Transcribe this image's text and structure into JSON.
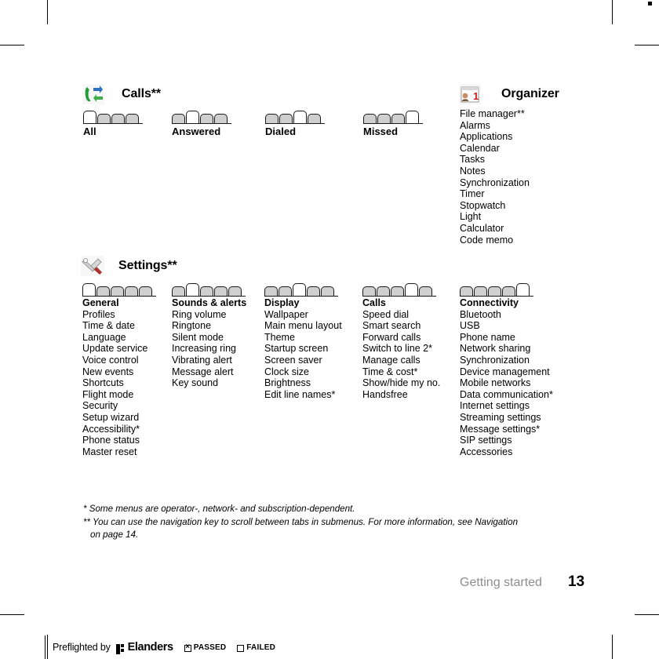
{
  "document": {
    "footer_label": "Getting started",
    "page_number": "13"
  },
  "sections": {
    "calls": {
      "icon": "calls-icon",
      "title": "Calls**",
      "tabs": [
        {
          "label": "All",
          "count": 4,
          "selected_index": 0
        },
        {
          "label": "Answered",
          "count": 4,
          "selected_index": 1
        },
        {
          "label": "Dialed",
          "count": 4,
          "selected_index": 2
        },
        {
          "label": "Missed",
          "count": 4,
          "selected_index": 3
        }
      ]
    },
    "organizer": {
      "icon": "organizer-icon",
      "title": "Organizer",
      "items": [
        "File manager**",
        "Alarms",
        "Applications",
        "Calendar",
        "Tasks",
        "Notes",
        "Synchronization",
        "Timer",
        "Stopwatch",
        "Light",
        "Calculator",
        "Code memo"
      ]
    },
    "settings": {
      "icon": "settings-icon",
      "title": "Settings**",
      "columns": [
        {
          "header": "General",
          "tab_count": 5,
          "selected_index": 0,
          "items": [
            "Profiles",
            "Time & date",
            "Language",
            "Update service",
            "Voice control",
            "New events",
            "Shortcuts",
            "Flight mode",
            "Security",
            "Setup wizard",
            "Accessibility*",
            "Phone status",
            "Master reset"
          ]
        },
        {
          "header": "Sounds & alerts",
          "tab_count": 5,
          "selected_index": 1,
          "items": [
            "Ring volume",
            "Ringtone",
            "Silent mode",
            "Increasing ring",
            "Vibrating alert",
            "Message alert",
            "Key sound"
          ]
        },
        {
          "header": "Display",
          "tab_count": 5,
          "selected_index": 2,
          "items": [
            "Wallpaper",
            "Main menu layout",
            "Theme",
            "Startup screen",
            "Screen saver",
            "Clock size",
            "Brightness",
            "Edit line names*"
          ]
        },
        {
          "header": "Calls",
          "tab_count": 5,
          "selected_index": 3,
          "items": [
            "Speed dial",
            "Smart search",
            "Forward calls",
            "Switch to line 2*",
            "Manage calls",
            "Time & cost*",
            "Show/hide my no.",
            "Handsfree"
          ]
        },
        {
          "header": "Connectivity",
          "tab_count": 5,
          "selected_index": 4,
          "items": [
            "Bluetooth",
            "USB",
            "Phone name",
            "Network sharing",
            "Synchronization",
            "Device management",
            "Mobile networks",
            "Data communication*",
            "Internet settings",
            "Streaming settings",
            "Message settings*",
            "SIP settings",
            "Accessories"
          ]
        }
      ]
    }
  },
  "footnotes": {
    "line1": "* Some menus are operator-, network- and subscription-dependent.",
    "line2": "** You can use the navigation key to scroll between tabs in submenus. For more information, see Navigation",
    "line3": "on page 14."
  },
  "preflight": {
    "prefix": "Preflighted by",
    "brand": "Elanders",
    "passed_label": "PASSED",
    "failed_label": "FAILED",
    "passed_checked": true,
    "failed_checked": false
  },
  "colors": {
    "tab_selected": "#ffffff",
    "tab_unselected": "#cfcfcf",
    "tab_border": "#1a1a1a",
    "footer_label": "#8d8d8d",
    "text": "#000000"
  }
}
